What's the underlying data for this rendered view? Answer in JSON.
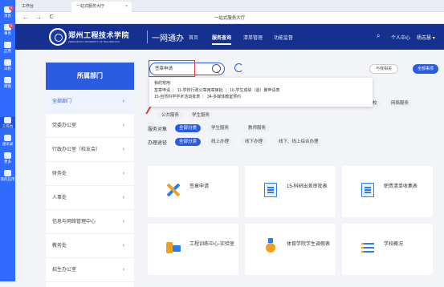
{
  "leftbar": {
    "items": [
      {
        "label": "消息",
        "badge": "1"
      },
      {
        "label": "事务",
        "badge": "1"
      },
      {
        "label": "应用"
      },
      {
        "label": "日程"
      },
      {
        "label": "网盘"
      },
      {
        "label": "工作台"
      },
      {
        "label": "通讯录"
      },
      {
        "label": "更多"
      },
      {
        "label": "我的应用"
      }
    ]
  },
  "tabs": [
    {
      "label": "工作台"
    },
    {
      "label": "一站式服务大厅",
      "close": "×"
    }
  ],
  "nav": {
    "back": "←",
    "forward": "→",
    "reload": "C",
    "page_title": "一站式服务大厅"
  },
  "header": {
    "school_name": "郑州工程技术学院",
    "school_en": "ZHENGZHOU UNIVERSITY OF TECHNOLOGY",
    "brand": "一网通办",
    "nav": [
      "首页",
      "服务查询",
      "清单管理",
      "功能监督"
    ],
    "user_center": "个人中心",
    "user_name": "杨志慧"
  },
  "sidebar": {
    "title": "所属部门",
    "items": [
      {
        "label": "全部部门"
      },
      {
        "label": "党委办公室"
      },
      {
        "label": "行政办公室（校友会）"
      },
      {
        "label": "财务处"
      },
      {
        "label": "人事处"
      },
      {
        "label": "信息与网络管理中心"
      },
      {
        "label": "教务处"
      },
      {
        "label": "招生办公室"
      }
    ],
    "chevron": "›"
  },
  "search": {
    "value": "签章申请",
    "dropdown_title": "我的常用:",
    "recent": [
      "签章申请",
      "11-学校行政公章用章审批",
      "16-学生成绩（退）聚申请表",
      "15-自然科学学术活动批表",
      "34-多媒体教室预约"
    ]
  },
  "actions": {
    "visited": "与我相关",
    "all_items": "全部事项"
  },
  "tags": {
    "row_partial": [
      "校",
      "网络服务"
    ],
    "row1": [
      "公共服务",
      "学生服务"
    ],
    "service_target_label": "服务对象",
    "service_targets": [
      "全部分类",
      "学生服务",
      "教师服务"
    ],
    "channel_label": "办理途径",
    "channels": [
      "全部分类",
      "线上办理",
      "线下办理",
      "线下、线上综合办理"
    ]
  },
  "cards": [
    {
      "title": "签章申请",
      "icon": "pen-ruler-icon"
    },
    {
      "title": "15-科研出差审批表",
      "icon": "document-icon"
    },
    {
      "title": "职责清单收集表",
      "icon": "document-icon"
    },
    {
      "title": "工程训练中心-实验室",
      "icon": "key-tool-icon"
    },
    {
      "title": "体育学院学生调假表",
      "icon": "medal-icon"
    },
    {
      "title": "学校概况",
      "icon": "list-icon"
    }
  ],
  "colors": {
    "accent": "#2b5be0",
    "header": "#15308f",
    "highlight": "#e53935"
  }
}
